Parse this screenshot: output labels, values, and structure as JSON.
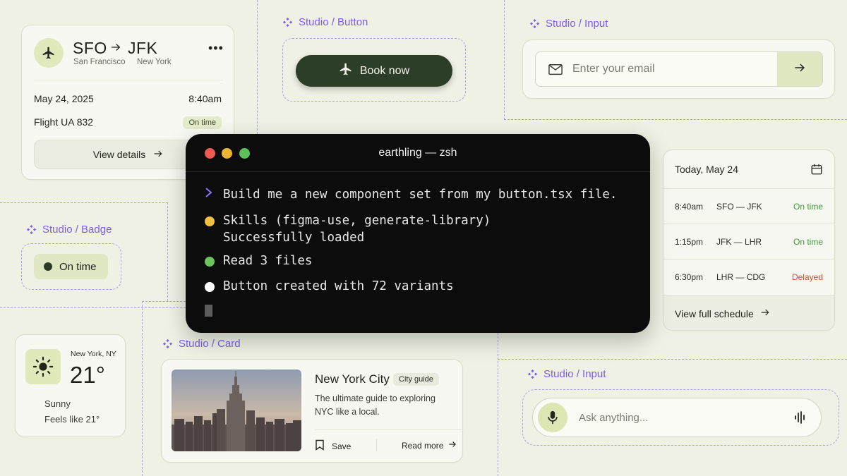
{
  "colors": {
    "background": "#eef1e3",
    "accent": "#7c5cf0",
    "dark_green": "#2c3d28",
    "light_green": "#dfe8c0",
    "status_ok": "#3f9a3b",
    "status_delayed": "#d94a2a"
  },
  "studio_labels": {
    "button": "Studio / Button",
    "input_top": "Studio / Input",
    "badge": "Studio / Badge",
    "card": "Studio / Card",
    "input_bottom": "Studio / Input"
  },
  "flight_card": {
    "from_code": "SFO",
    "to_code": "JFK",
    "from_city": "San Francisco",
    "to_city": "New York",
    "date": "May 24, 2025",
    "time": "8:40am",
    "flight": "Flight UA 832",
    "status": "On time",
    "view_details": "View details",
    "icon": "plane-icon"
  },
  "book_button": {
    "label": "Book now",
    "icon": "plane-icon"
  },
  "email_input": {
    "placeholder": "Enter your email",
    "icon": "mail-icon",
    "submit_icon": "arrow-right-icon"
  },
  "terminal": {
    "title": "earthling — zsh",
    "prompt": "Build me a new component set from my button.tsx file.",
    "lines": [
      {
        "text": "Skills (figma-use, generate-library)",
        "bullet": "#f0c040"
      },
      {
        "text": "Successfully loaded",
        "bullet": ""
      },
      {
        "text": "Read 3 files",
        "bullet": "#6cc35b"
      },
      {
        "text": "Button created with 72 variants",
        "bullet": "#ffffff"
      }
    ]
  },
  "badge": {
    "label": "On time"
  },
  "schedule": {
    "header": "Today, May 24",
    "rows": [
      {
        "time": "8:40am",
        "from": "SFO",
        "to": "JFK",
        "status": "On time"
      },
      {
        "time": "1:15pm",
        "from": "JFK",
        "to": "LHR",
        "status": "On time"
      },
      {
        "time": "6:30pm",
        "from": "LHR",
        "to": "CDG",
        "status": "Delayed"
      }
    ],
    "view_full": "View full schedule"
  },
  "weather": {
    "location": "New York, NY",
    "temp": "21°",
    "condition": "Sunny",
    "feels_like": "Feels like 21°"
  },
  "city_card": {
    "title": "New York City",
    "tag": "City guide",
    "description": "The ultimate guide to exploring NYC like a local.",
    "save": "Save",
    "read_more": "Read more"
  },
  "ask_input": {
    "placeholder": "Ask anything...",
    "mic_icon": "microphone-icon",
    "wave_icon": "waveform-icon"
  }
}
